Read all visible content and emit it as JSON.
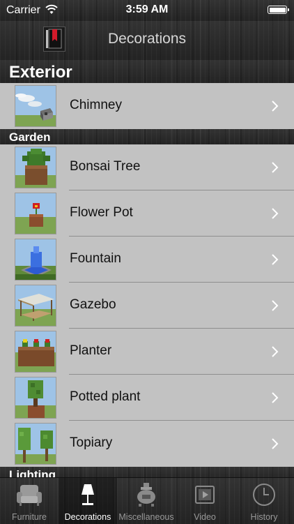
{
  "status_bar": {
    "carrier": "Carrier",
    "time": "3:59 AM",
    "battery_level": 1.0
  },
  "nav": {
    "title": "Decorations",
    "logo_icon": "bookmark-book-icon"
  },
  "sections": [
    {
      "title": "Exterior",
      "items": [
        {
          "label": "Chimney",
          "icon": "chimney-thumbnail"
        }
      ]
    },
    {
      "title": "Garden",
      "items": [
        {
          "label": "Bonsai Tree",
          "icon": "bonsai-tree-thumbnail"
        },
        {
          "label": "Flower Pot",
          "icon": "flower-pot-thumbnail"
        },
        {
          "label": "Fountain",
          "icon": "fountain-thumbnail"
        },
        {
          "label": "Gazebo",
          "icon": "gazebo-thumbnail"
        },
        {
          "label": "Planter",
          "icon": "planter-thumbnail"
        },
        {
          "label": "Potted plant",
          "icon": "potted-plant-thumbnail"
        },
        {
          "label": "Topiary",
          "icon": "topiary-thumbnail"
        }
      ]
    },
    {
      "title": "Lighting",
      "items": []
    }
  ],
  "tabs": [
    {
      "label": "Furniture",
      "icon": "armchair-icon",
      "active": false
    },
    {
      "label": "Decorations",
      "icon": "lamp-icon",
      "active": true
    },
    {
      "label": "Miscellaneous",
      "icon": "stove-icon",
      "active": false
    },
    {
      "label": "Video",
      "icon": "video-icon",
      "active": false
    },
    {
      "label": "History",
      "icon": "clock-icon",
      "active": false
    }
  ],
  "colors": {
    "row_background": "#c2c2c2",
    "tab_active_label": "#ffffff",
    "tab_inactive_label": "#999999",
    "chevron": "#ffffff"
  }
}
